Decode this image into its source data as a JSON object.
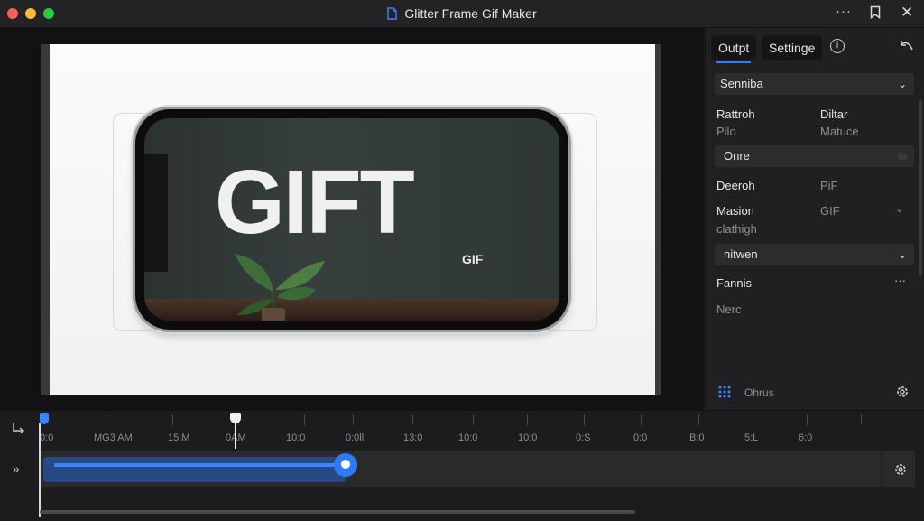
{
  "window": {
    "title": "Glitter Frame Gif Maker"
  },
  "preview": {
    "headline": "GIFT",
    "badge": "GIF"
  },
  "panel": {
    "tabs": [
      {
        "label": "Outpt"
      },
      {
        "label": "Settinge"
      }
    ],
    "preset": {
      "value": "Senniba"
    },
    "rows": [
      {
        "label": "Rattroh",
        "value": "Pilo"
      },
      {
        "label": "Diltar",
        "value": "Matuce"
      }
    ],
    "option_field": {
      "value": "Onre"
    },
    "deeroh": {
      "label": "Deeroh",
      "value": "PiF"
    },
    "masion": {
      "label": "Masion",
      "value": "GIF",
      "sub": "clathigh"
    },
    "network_field": {
      "value": "nitwen"
    },
    "fannis": {
      "label": "Fannis",
      "sub": "Nerc"
    },
    "footer": {
      "label": "Ohrus"
    }
  },
  "timeline": {
    "tick_labels": [
      "0:0",
      "MG3 AM",
      "15:M",
      "0AM",
      "10:0",
      "0:0ll",
      "13:0",
      "10:0",
      "10:0",
      "0:S",
      "0:0",
      "B:0",
      "5:L",
      "6:0"
    ],
    "clip_progress": 0.36
  },
  "colors": {
    "accent": "#2f7bf6",
    "clip": "#274a86"
  }
}
